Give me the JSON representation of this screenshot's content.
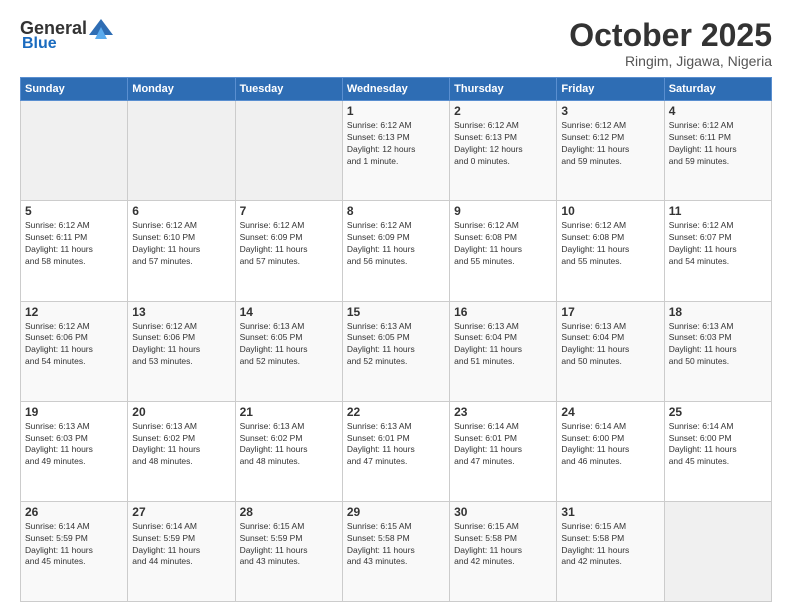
{
  "header": {
    "logo": {
      "general": "General",
      "blue": "Blue"
    },
    "title": "October 2025",
    "location": "Ringim, Jigawa, Nigeria"
  },
  "calendar": {
    "weekdays": [
      "Sunday",
      "Monday",
      "Tuesday",
      "Wednesday",
      "Thursday",
      "Friday",
      "Saturday"
    ],
    "weeks": [
      [
        {
          "day": "",
          "info": ""
        },
        {
          "day": "",
          "info": ""
        },
        {
          "day": "",
          "info": ""
        },
        {
          "day": "1",
          "info": "Sunrise: 6:12 AM\nSunset: 6:13 PM\nDaylight: 12 hours\nand 1 minute."
        },
        {
          "day": "2",
          "info": "Sunrise: 6:12 AM\nSunset: 6:13 PM\nDaylight: 12 hours\nand 0 minutes."
        },
        {
          "day": "3",
          "info": "Sunrise: 6:12 AM\nSunset: 6:12 PM\nDaylight: 11 hours\nand 59 minutes."
        },
        {
          "day": "4",
          "info": "Sunrise: 6:12 AM\nSunset: 6:11 PM\nDaylight: 11 hours\nand 59 minutes."
        }
      ],
      [
        {
          "day": "5",
          "info": "Sunrise: 6:12 AM\nSunset: 6:11 PM\nDaylight: 11 hours\nand 58 minutes."
        },
        {
          "day": "6",
          "info": "Sunrise: 6:12 AM\nSunset: 6:10 PM\nDaylight: 11 hours\nand 57 minutes."
        },
        {
          "day": "7",
          "info": "Sunrise: 6:12 AM\nSunset: 6:09 PM\nDaylight: 11 hours\nand 57 minutes."
        },
        {
          "day": "8",
          "info": "Sunrise: 6:12 AM\nSunset: 6:09 PM\nDaylight: 11 hours\nand 56 minutes."
        },
        {
          "day": "9",
          "info": "Sunrise: 6:12 AM\nSunset: 6:08 PM\nDaylight: 11 hours\nand 55 minutes."
        },
        {
          "day": "10",
          "info": "Sunrise: 6:12 AM\nSunset: 6:08 PM\nDaylight: 11 hours\nand 55 minutes."
        },
        {
          "day": "11",
          "info": "Sunrise: 6:12 AM\nSunset: 6:07 PM\nDaylight: 11 hours\nand 54 minutes."
        }
      ],
      [
        {
          "day": "12",
          "info": "Sunrise: 6:12 AM\nSunset: 6:06 PM\nDaylight: 11 hours\nand 54 minutes."
        },
        {
          "day": "13",
          "info": "Sunrise: 6:12 AM\nSunset: 6:06 PM\nDaylight: 11 hours\nand 53 minutes."
        },
        {
          "day": "14",
          "info": "Sunrise: 6:13 AM\nSunset: 6:05 PM\nDaylight: 11 hours\nand 52 minutes."
        },
        {
          "day": "15",
          "info": "Sunrise: 6:13 AM\nSunset: 6:05 PM\nDaylight: 11 hours\nand 52 minutes."
        },
        {
          "day": "16",
          "info": "Sunrise: 6:13 AM\nSunset: 6:04 PM\nDaylight: 11 hours\nand 51 minutes."
        },
        {
          "day": "17",
          "info": "Sunrise: 6:13 AM\nSunset: 6:04 PM\nDaylight: 11 hours\nand 50 minutes."
        },
        {
          "day": "18",
          "info": "Sunrise: 6:13 AM\nSunset: 6:03 PM\nDaylight: 11 hours\nand 50 minutes."
        }
      ],
      [
        {
          "day": "19",
          "info": "Sunrise: 6:13 AM\nSunset: 6:03 PM\nDaylight: 11 hours\nand 49 minutes."
        },
        {
          "day": "20",
          "info": "Sunrise: 6:13 AM\nSunset: 6:02 PM\nDaylight: 11 hours\nand 48 minutes."
        },
        {
          "day": "21",
          "info": "Sunrise: 6:13 AM\nSunset: 6:02 PM\nDaylight: 11 hours\nand 48 minutes."
        },
        {
          "day": "22",
          "info": "Sunrise: 6:13 AM\nSunset: 6:01 PM\nDaylight: 11 hours\nand 47 minutes."
        },
        {
          "day": "23",
          "info": "Sunrise: 6:14 AM\nSunset: 6:01 PM\nDaylight: 11 hours\nand 47 minutes."
        },
        {
          "day": "24",
          "info": "Sunrise: 6:14 AM\nSunset: 6:00 PM\nDaylight: 11 hours\nand 46 minutes."
        },
        {
          "day": "25",
          "info": "Sunrise: 6:14 AM\nSunset: 6:00 PM\nDaylight: 11 hours\nand 45 minutes."
        }
      ],
      [
        {
          "day": "26",
          "info": "Sunrise: 6:14 AM\nSunset: 5:59 PM\nDaylight: 11 hours\nand 45 minutes."
        },
        {
          "day": "27",
          "info": "Sunrise: 6:14 AM\nSunset: 5:59 PM\nDaylight: 11 hours\nand 44 minutes."
        },
        {
          "day": "28",
          "info": "Sunrise: 6:15 AM\nSunset: 5:59 PM\nDaylight: 11 hours\nand 43 minutes."
        },
        {
          "day": "29",
          "info": "Sunrise: 6:15 AM\nSunset: 5:58 PM\nDaylight: 11 hours\nand 43 minutes."
        },
        {
          "day": "30",
          "info": "Sunrise: 6:15 AM\nSunset: 5:58 PM\nDaylight: 11 hours\nand 42 minutes."
        },
        {
          "day": "31",
          "info": "Sunrise: 6:15 AM\nSunset: 5:58 PM\nDaylight: 11 hours\nand 42 minutes."
        },
        {
          "day": "",
          "info": ""
        }
      ]
    ]
  }
}
